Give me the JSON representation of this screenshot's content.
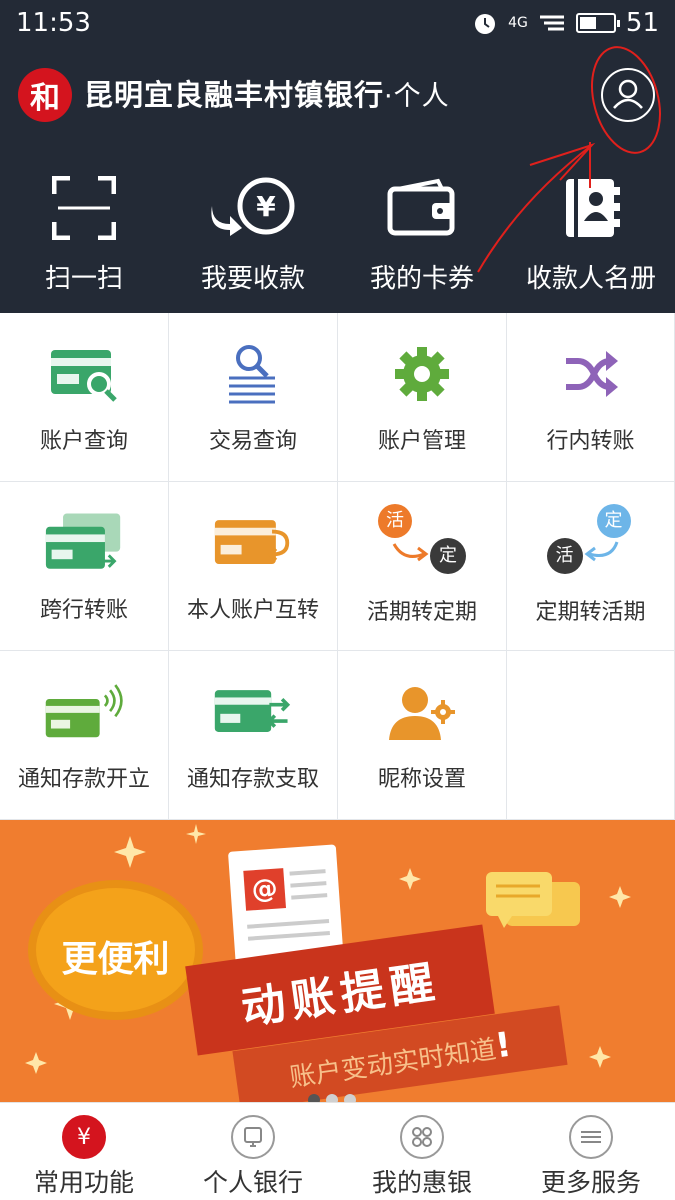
{
  "status": {
    "time": "11:53",
    "network": "4G",
    "battery": "51",
    "battery_level_pct": 51
  },
  "header": {
    "logo_char": "和",
    "bank_name": "昆明宜良融丰村镇银行",
    "mode": "·个人",
    "quick_actions": [
      {
        "label": "扫一扫",
        "icon": "scan-icon"
      },
      {
        "label": "我要收款",
        "icon": "receive-money-icon"
      },
      {
        "label": "我的卡券",
        "icon": "wallet-icon"
      },
      {
        "label": "收款人名册",
        "icon": "payee-book-icon"
      }
    ]
  },
  "grid": {
    "items": [
      {
        "label": "账户查询",
        "icon": "account-query-icon"
      },
      {
        "label": "交易查询",
        "icon": "transaction-query-icon"
      },
      {
        "label": "账户管理",
        "icon": "gear-icon"
      },
      {
        "label": "行内转账",
        "icon": "shuffle-icon"
      },
      {
        "label": "跨行转账",
        "icon": "interbank-transfer-icon"
      },
      {
        "label": "本人账户互转",
        "icon": "self-transfer-icon"
      },
      {
        "label": "活期转定期",
        "icon": "current-to-fixed-icon"
      },
      {
        "label": "定期转活期",
        "icon": "fixed-to-current-icon"
      },
      {
        "label": "通知存款开立",
        "icon": "notice-deposit-open-icon"
      },
      {
        "label": "通知存款支取",
        "icon": "notice-deposit-withdraw-icon"
      },
      {
        "label": "昵称设置",
        "icon": "nickname-settings-icon"
      }
    ],
    "badge_huo": "活",
    "badge_ding": "定"
  },
  "banner": {
    "bubble": "更便利",
    "headline": "动账提醒",
    "subline": "账户变动实时知道",
    "exclaim": "!",
    "email_symbol": "@"
  },
  "tabbar": {
    "tabs": [
      {
        "label": "常用功能",
        "icon": "yuan-icon",
        "glyph": "¥",
        "active": true
      },
      {
        "label": "个人银行",
        "icon": "phone-icon",
        "glyph": "",
        "active": false
      },
      {
        "label": "我的惠银",
        "icon": "apps-icon",
        "glyph": "",
        "active": false
      },
      {
        "label": "更多服务",
        "icon": "menu-icon",
        "glyph": "",
        "active": false
      }
    ]
  },
  "colors": {
    "header_bg": "#232a36",
    "brand_red": "#d4141e",
    "green": "#3aa66a",
    "blue": "#4a6fbf",
    "purple": "#8e63b8",
    "orange": "#e8952b",
    "banner_bg": "#f07d2f"
  }
}
